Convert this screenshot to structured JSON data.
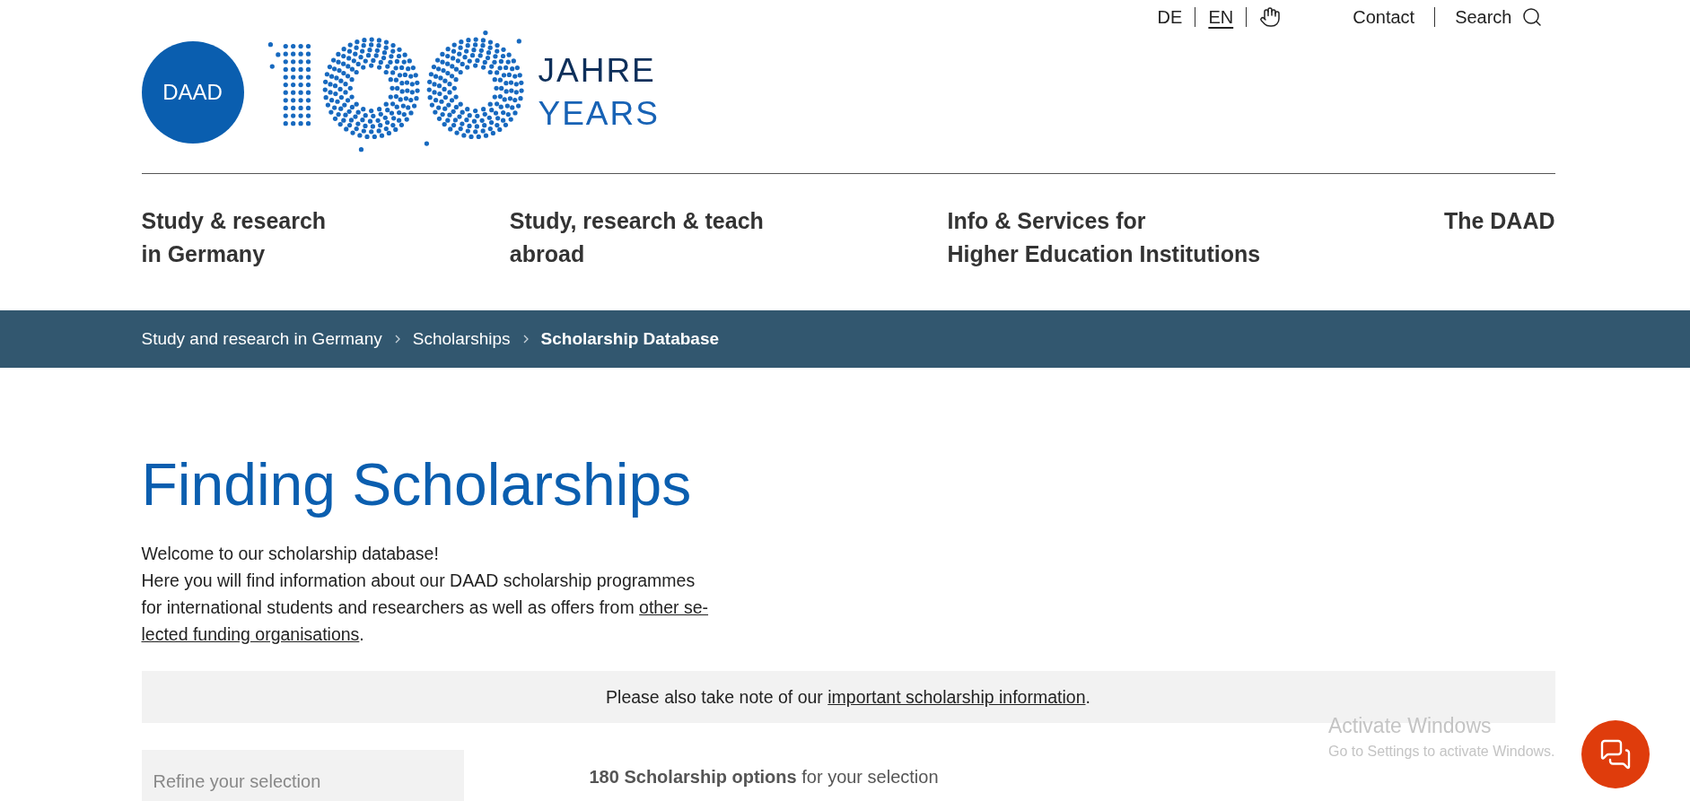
{
  "utility_bar": {
    "languages": [
      {
        "label": "DE",
        "selected": false
      },
      {
        "label": "EN",
        "selected": true
      }
    ],
    "links": [
      {
        "label": "Contact",
        "kind": "text"
      },
      {
        "label": "Search",
        "kind": "search"
      }
    ]
  },
  "logo": {
    "badge": "DAAD",
    "line_1": "JAHRE",
    "line_2": "YEARS"
  },
  "main_nav": [
    {
      "lines": [
        "Study & research",
        "in Germany"
      ]
    },
    {
      "lines": [
        "Study, research & teach",
        "abroad"
      ]
    },
    {
      "lines": [
        "Info & Services for",
        "Higher Education Institutions"
      ]
    },
    {
      "lines": [
        "The DAAD"
      ]
    }
  ],
  "breadcrumb": [
    {
      "label": "Study and research in Germany",
      "current": false
    },
    {
      "label": "Scholarships",
      "current": false
    },
    {
      "label": "Scholarship Database",
      "current": true
    }
  ],
  "page_title": "Finding Scholarships",
  "intro": {
    "lines": [
      "Welcome to our scholarship database!",
      "Here you will find information about our DAAD scholarship programmes",
      "for international students and researchers as well as offers from "
    ],
    "link_lines": [
      "other se-",
      "lected funding organisations"
    ],
    "end": "."
  },
  "notice": {
    "text": "Please also take note of our ",
    "link": "important scholarship information",
    "end": "."
  },
  "sidebar": {
    "heading": "Refine your selection"
  },
  "results": {
    "summary": "**180 Scholarship options** for your selection"
  },
  "os_overlay": {
    "title": "Activate Windows",
    "hint": "Go to Settings to activate Windows."
  }
}
